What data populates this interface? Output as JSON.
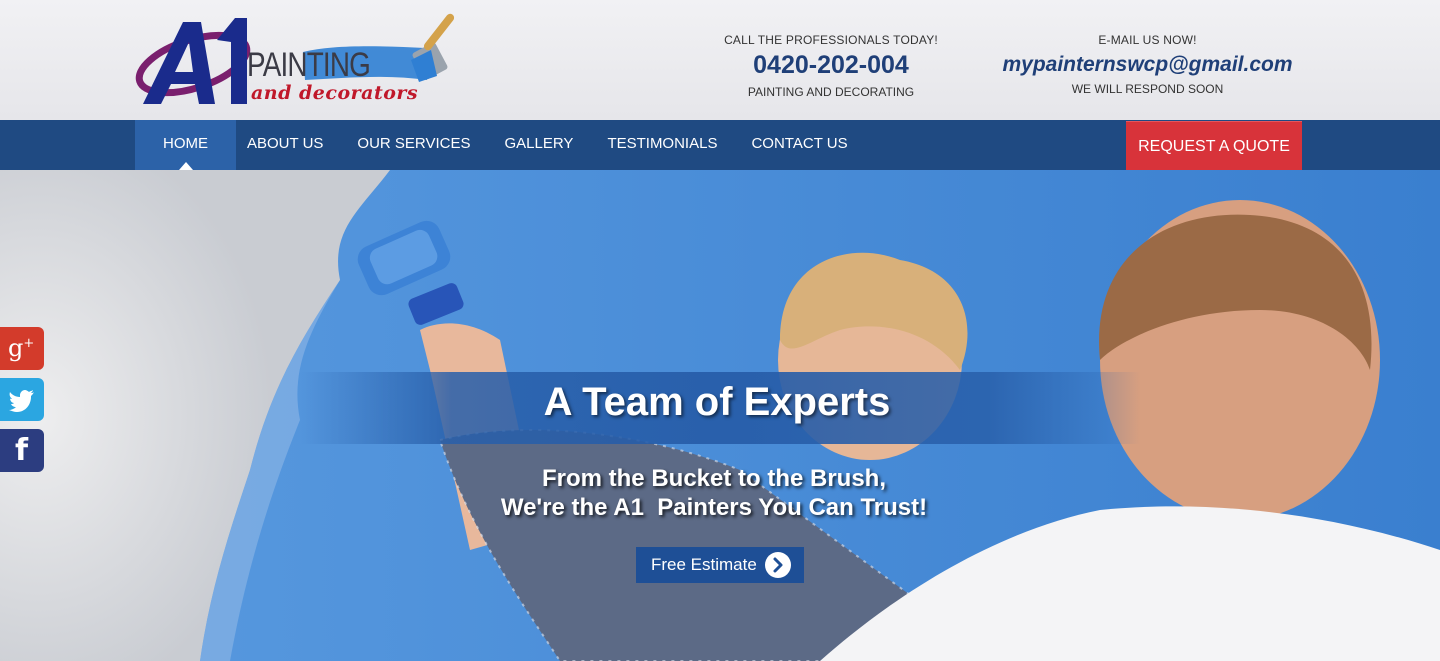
{
  "brand": {
    "logo_letters": "A1",
    "logo_word": "PAINTING",
    "logo_tagline": "and decorators"
  },
  "contact_phone": {
    "top": "CALL THE PROFESSIONALS TODAY!",
    "number": "0420-202-004",
    "bottom": "PAINTING AND DECORATING"
  },
  "contact_email": {
    "top": "E-MAIL US NOW!",
    "email": "mypainternswcp@gmail.com",
    "bottom": "WE WILL RESPOND SOON"
  },
  "nav": {
    "items": [
      {
        "label": "HOME",
        "active": true
      },
      {
        "label": "ABOUT US"
      },
      {
        "label": "OUR SERVICES"
      },
      {
        "label": "GALLERY"
      },
      {
        "label": "TESTIMONIALS"
      },
      {
        "label": "CONTACT US"
      }
    ],
    "quote_label": "REQUEST A QUOTE"
  },
  "hero": {
    "title": "A Team of Experts",
    "subtitle_line1": "From the Bucket to the Brush,",
    "subtitle_line2": "We're the A1  Painters You Can Trust!",
    "cta_label": "Free Estimate"
  },
  "social": {
    "gplus_icon": "google-plus-icon",
    "twitter_icon": "twitter-icon",
    "facebook_icon": "facebook-icon"
  },
  "colors": {
    "nav_bg": "#1f4a82",
    "nav_active": "#2c62a8",
    "quote_red": "#d8333a",
    "brand_navy": "#1f3f78",
    "paint_blue": "#4a8fd6"
  }
}
